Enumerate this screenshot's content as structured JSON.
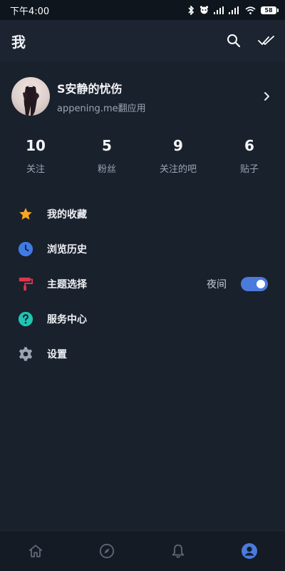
{
  "status_bar": {
    "time": "下午4:00",
    "battery": "58"
  },
  "header": {
    "title": "我",
    "search_icon": "search-icon",
    "read_all_icon": "double-check-icon"
  },
  "profile": {
    "name": "S安静的忧伤",
    "subtitle": "appening.me翻应用"
  },
  "stats": [
    {
      "value": "10",
      "label": "关注"
    },
    {
      "value": "5",
      "label": "粉丝"
    },
    {
      "value": "9",
      "label": "关注的吧"
    },
    {
      "value": "6",
      "label": "贴子"
    }
  ],
  "menu": [
    {
      "label": "我的收藏",
      "icon": "star-icon",
      "color": "#f5a623"
    },
    {
      "label": "浏览历史",
      "icon": "clock-icon",
      "color": "#3f7be6"
    },
    {
      "label": "主题选择",
      "icon": "paint-roller-icon",
      "color": "#e0344c",
      "value": "夜间",
      "toggle_on": true
    },
    {
      "label": "服务中心",
      "icon": "help-circle-icon",
      "color": "#1ec6b4"
    },
    {
      "label": "设置",
      "icon": "gear-icon",
      "color": "#9aa4b0"
    }
  ],
  "bottom_nav": [
    {
      "icon": "home-icon",
      "active": false
    },
    {
      "icon": "compass-icon",
      "active": false
    },
    {
      "icon": "bell-icon",
      "active": false
    },
    {
      "icon": "profile-icon",
      "active": true
    }
  ],
  "colors": {
    "background": "#19212c",
    "accent": "#4a7bdc",
    "inactive_nav": "#5d6875"
  }
}
